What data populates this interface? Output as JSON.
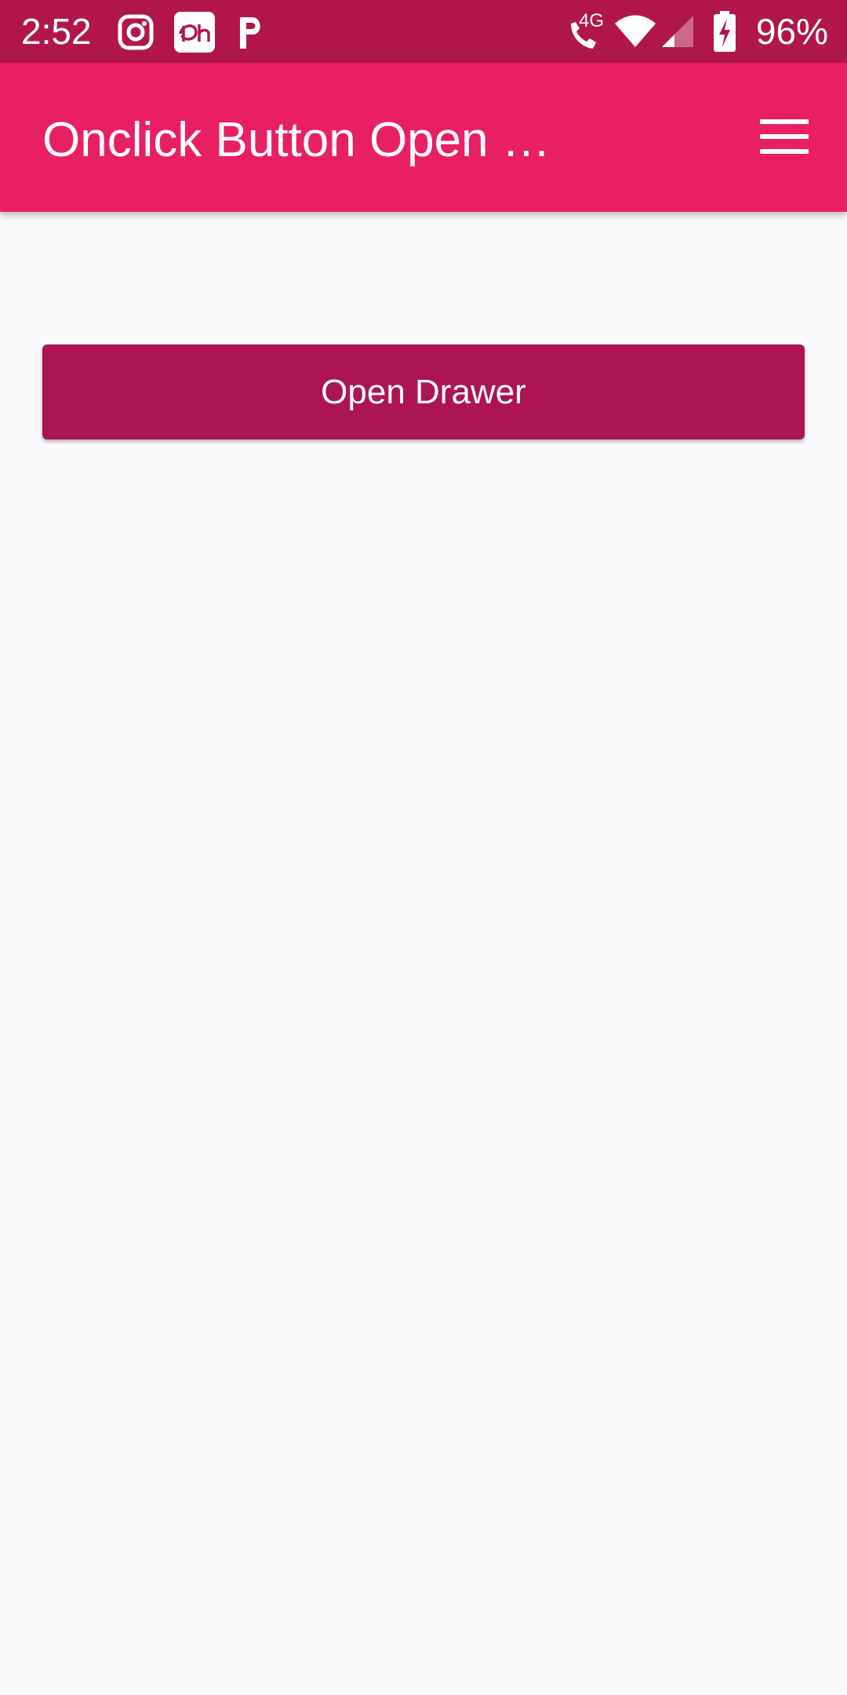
{
  "status_bar": {
    "time": "2:52",
    "battery_percent": "96%",
    "network_label": "4G",
    "notification_icons": [
      "instagram-icon",
      "disney-hotstar-icon",
      "parking-p-icon"
    ],
    "system_icons": [
      "call-4g-icon",
      "wifi-icon",
      "cellular-signal-icon",
      "battery-charging-icon"
    ],
    "background_color": "#B0164A"
  },
  "app_bar": {
    "title": "Onclick Button Open …",
    "menu_icon": "hamburger-menu-icon",
    "background_color": "#E91F63"
  },
  "main": {
    "open_drawer_label": "Open Drawer",
    "button_color": "#AD1452",
    "background_color": "#FAF9FB"
  }
}
